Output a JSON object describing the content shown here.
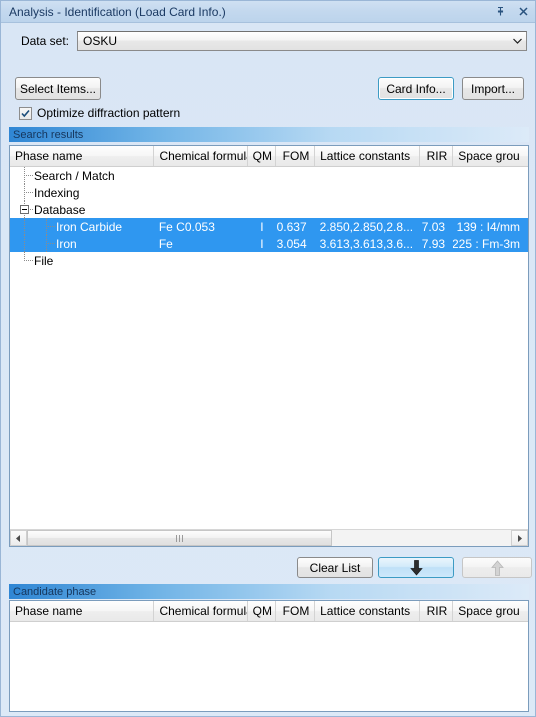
{
  "window": {
    "title": "Analysis - Identification (Load Card Info.)",
    "pin_icon": "pin-icon",
    "close_icon": "close-icon"
  },
  "dataset": {
    "label": "Data set:",
    "value": "OSKU",
    "dropdown_icon": "chevron-down-icon"
  },
  "toolbar": {
    "select_items_label": "Select Items...",
    "card_info_label": "Card Info...",
    "import_label": "Import..."
  },
  "options": {
    "optimize_label": "Optimize diffraction pattern",
    "optimize_checked": true,
    "check_icon": "check-icon"
  },
  "search_results": {
    "section_title": "Search results",
    "columns": [
      "Phase name",
      "Chemical formula",
      "QM",
      "FOM",
      "Lattice constants",
      "RIR",
      "Space grou"
    ],
    "tree": [
      {
        "label": "Search / Match",
        "depth": 1,
        "expander": false,
        "selected": false,
        "formula": "",
        "qm": "",
        "fom": "",
        "lattice": "",
        "rir": "",
        "space": ""
      },
      {
        "label": "Indexing",
        "depth": 1,
        "expander": false,
        "selected": false,
        "formula": "",
        "qm": "",
        "fom": "",
        "lattice": "",
        "rir": "",
        "space": ""
      },
      {
        "label": "Database",
        "depth": 1,
        "expander": true,
        "selected": false,
        "formula": "",
        "qm": "",
        "fom": "",
        "lattice": "",
        "rir": "",
        "space": ""
      },
      {
        "label": "Iron Carbide",
        "depth": 2,
        "expander": false,
        "selected": true,
        "formula": "Fe C0.053",
        "qm": "I",
        "fom": "0.637",
        "lattice": "2.850,2.850,2.8...",
        "rir": "7.03",
        "space": "139 : I4/mm"
      },
      {
        "label": "Iron",
        "depth": 2,
        "expander": false,
        "selected": true,
        "formula": "Fe",
        "qm": "I",
        "fom": "3.054",
        "lattice": "3.613,3.613,3.6...",
        "rir": "7.93",
        "space": "225 : Fm-3m"
      },
      {
        "label": "File",
        "depth": 1,
        "expander": false,
        "selected": false,
        "formula": "",
        "qm": "",
        "fom": "",
        "lattice": "",
        "rir": "",
        "space": ""
      }
    ],
    "scroll_left_icon": "triangle-left-icon",
    "scroll_right_icon": "triangle-right-icon"
  },
  "actions": {
    "clear_list_label": "Clear List",
    "move_down_icon": "arrow-down-icon",
    "move_up_icon": "arrow-up-icon",
    "move_up_disabled": true
  },
  "candidate_phase": {
    "section_title": "Candidate phase",
    "columns": [
      "Phase name",
      "Chemical formula",
      "QM",
      "FOM",
      "Lattice constants",
      "RIR",
      "Space grou"
    ],
    "rows": []
  },
  "colors": {
    "selection": "#2f97f0",
    "section_header": "#2f86d4",
    "focus_border": "#3c9bc4",
    "titlebar_text": "#1b3a63"
  }
}
